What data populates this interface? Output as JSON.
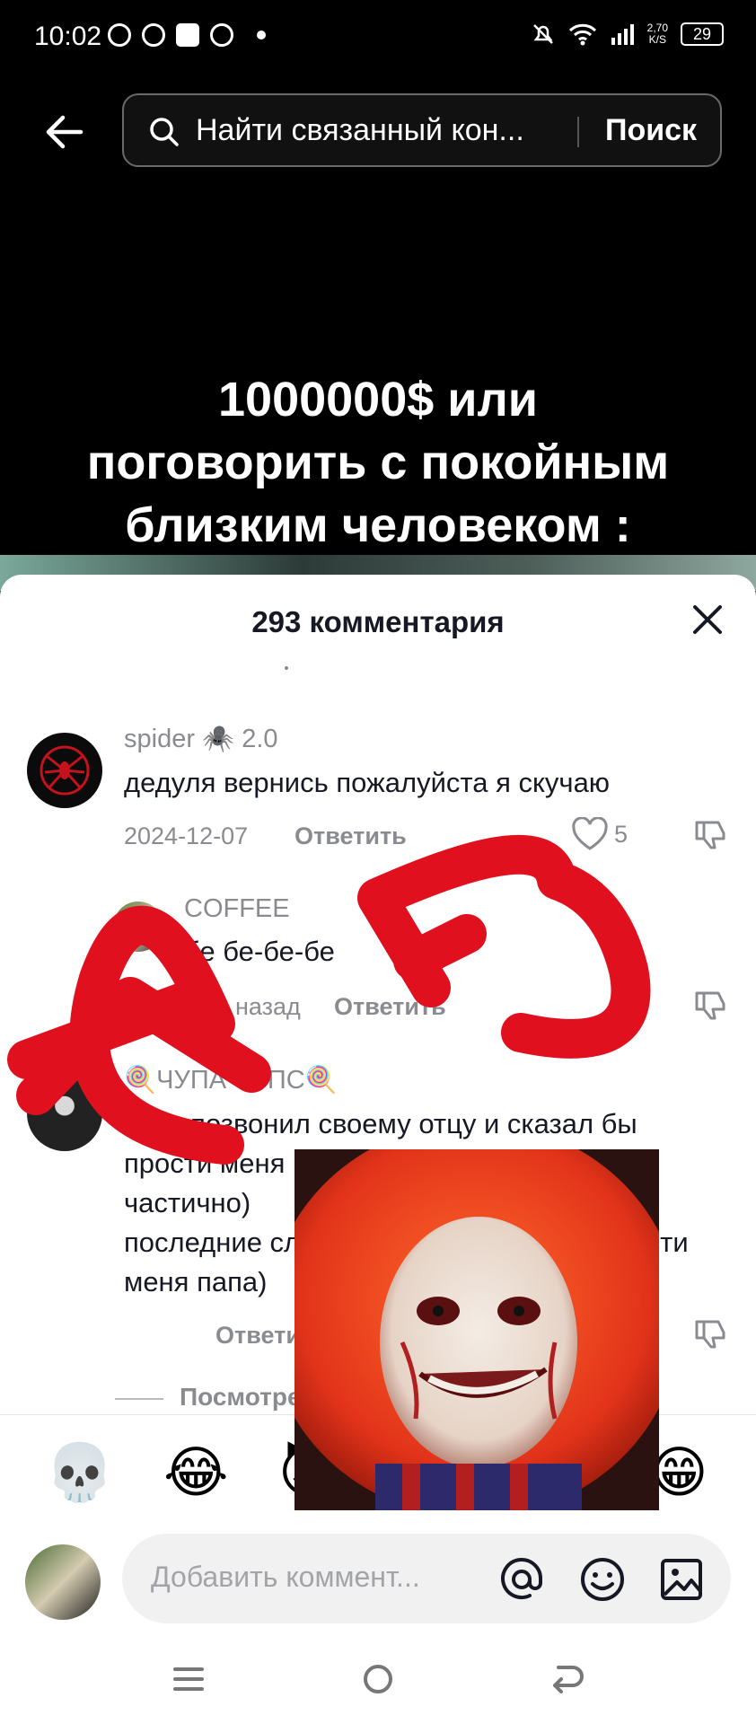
{
  "status_bar": {
    "time": "10:02",
    "speed_value": "2,70",
    "speed_unit": "K/S",
    "battery": "29"
  },
  "search": {
    "placeholder": "Найти связанный кон...",
    "button_label": "Поиск"
  },
  "video": {
    "caption_lines": [
      "1000000$ или",
      "поговорить с покойным",
      "близким человеком :"
    ]
  },
  "comments_panel": {
    "title": "293 комментария",
    "comments": [
      {
        "username": "spider 🕷️ 2.0",
        "text": "дедуля вернись пожалуйста я скучаю",
        "date": "2024-12-07",
        "reply_label": "Ответить",
        "likes": "5"
      },
      {
        "username": "COFFEE",
        "text": "бе бе-бе-бе",
        "date": "назад",
        "reply_label": "Ответить"
      },
      {
        "username": "🍭ЧУПА ЧУПС🍭",
        "text_lines": [
          "я бы позвонил своему отцу и сказал бы",
          "прости меня",
          "частично)",
          "последние слова которые он сказал прости",
          "меня папа)"
        ],
        "reply_label": "Ответить"
      }
    ],
    "view_more": "Посмотреть"
  },
  "emoji_bar": [
    "💀",
    "😂",
    "😈",
    "😁"
  ],
  "input": {
    "placeholder": "Добавить коммент..."
  },
  "colors": {
    "overlay_red": "#e0101e",
    "accent_like": "#8a8b91"
  },
  "icons": [
    "back-arrow-icon",
    "search-icon",
    "close-icon",
    "heart-icon",
    "dislike-icon",
    "at-icon",
    "emoji-icon",
    "image-icon",
    "menu-icon",
    "home-icon",
    "return-icon"
  ]
}
